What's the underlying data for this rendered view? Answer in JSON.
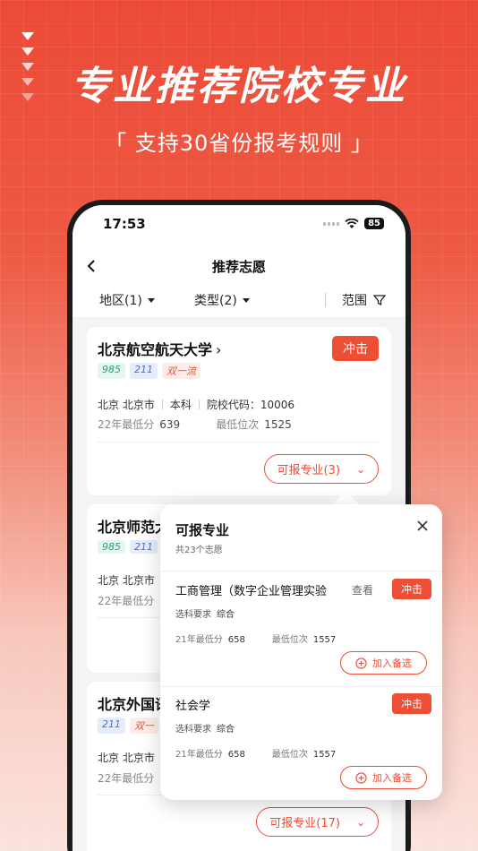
{
  "promo": {
    "headline": "专业推荐院校专业",
    "subline": "「 支持30省份报考规则 」"
  },
  "status": {
    "time": "17:53",
    "battery": "85"
  },
  "nav": {
    "title": "推荐志愿"
  },
  "filters": {
    "region": "地区(1)",
    "type": "类型(2)",
    "range": "范围"
  },
  "cards": [
    {
      "name": "北京航空航天大学",
      "tags": [
        "985",
        "211",
        "双一流"
      ],
      "rush": "冲击",
      "city": "北京 北京市",
      "level": "本科",
      "code": "院校代码：10006",
      "min_score_label": "22年最低分",
      "min_score": "639",
      "min_rank_label": "最低位次",
      "min_rank": "1525",
      "majors_btn": "可报专业(3)"
    },
    {
      "name": "北京师范大",
      "tags": [
        "985",
        "211"
      ],
      "city": "北京 北京市",
      "min_score_label": "22年最低分"
    },
    {
      "name": "北京外国语",
      "tags": [
        "211",
        "双一"
      ],
      "city": "北京 北京市",
      "min_score_label": "22年最低分",
      "majors_btn": "可报专业(17)"
    }
  ],
  "popup": {
    "title": "可报专业",
    "subtitle": "共23个志愿",
    "majors": [
      {
        "name": "工商管理（数字企业管理实验",
        "view": "查看",
        "rush": "冲击",
        "req_label": "选科要求",
        "req": "综合",
        "score_label": "21年最低分",
        "score": "658",
        "rank_label": "最低位次",
        "rank": "1557",
        "add": "加入备选"
      },
      {
        "name": "社会学",
        "rush": "冲击",
        "req_label": "选科要求",
        "req": "综合",
        "score_label": "21年最低分",
        "score": "658",
        "rank_label": "最低位次",
        "rank": "1557",
        "add": "加入备选"
      }
    ]
  },
  "colors": {
    "accent": "#ee4e34",
    "bg_top": "#ec4a36"
  }
}
